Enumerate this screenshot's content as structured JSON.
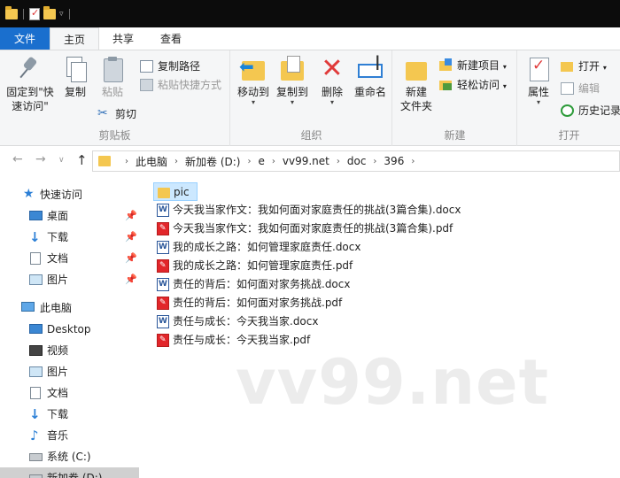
{
  "ribbon_tabs": [
    {
      "label": "文件"
    },
    {
      "label": "主页"
    },
    {
      "label": "共享"
    },
    {
      "label": "查看"
    }
  ],
  "ribbon": {
    "clipboard": {
      "label": "剪贴板",
      "pin_line1": "固定到\"快",
      "pin_line2": "速访问\"",
      "copy": "复制",
      "paste": "粘贴",
      "copy_path": "复制路径",
      "paste_shortcut": "粘贴快捷方式",
      "cut": "剪切"
    },
    "organize": {
      "label": "组织",
      "move_to": "移动到",
      "copy_to": "复制到",
      "delete": "删除",
      "rename": "重命名"
    },
    "new": {
      "label": "新建",
      "new_folder_line1": "新建",
      "new_folder_line2": "文件夹",
      "new_item": "新建项目",
      "easy_access": "轻松访问"
    },
    "open": {
      "label": "打开",
      "properties": "属性",
      "open": "打开",
      "edit": "编辑",
      "history": "历史记录"
    }
  },
  "address": {
    "crumbs": [
      "此电脑",
      "新加卷 (D:)",
      "e",
      "vv99.net",
      "doc",
      "396"
    ]
  },
  "nav": {
    "quick_access": "快速访问",
    "quick_items": [
      "桌面",
      "下载",
      "文档",
      "图片"
    ],
    "this_pc": "此电脑",
    "pc_items": [
      "Desktop",
      "视频",
      "图片",
      "文档",
      "下载",
      "音乐",
      "系统 (C:)",
      "新加卷 (D:)"
    ]
  },
  "files": [
    {
      "name": "pic",
      "type": "folder"
    },
    {
      "name": "今天我当家作文：我如何面对家庭责任的挑战(3篇合集).docx",
      "type": "word"
    },
    {
      "name": "今天我当家作文：我如何面对家庭责任的挑战(3篇合集).pdf",
      "type": "pdf"
    },
    {
      "name": "我的成长之路：如何管理家庭责任.docx",
      "type": "word"
    },
    {
      "name": "我的成长之路：如何管理家庭责任.pdf",
      "type": "pdf"
    },
    {
      "name": "责任的背后：如何面对家务挑战.docx",
      "type": "word"
    },
    {
      "name": "责任的背后：如何面对家务挑战.pdf",
      "type": "pdf"
    },
    {
      "name": "责任与成长：今天我当家.docx",
      "type": "word"
    },
    {
      "name": "责任与成长：今天我当家.pdf",
      "type": "pdf"
    }
  ],
  "watermark": "vv99.net"
}
